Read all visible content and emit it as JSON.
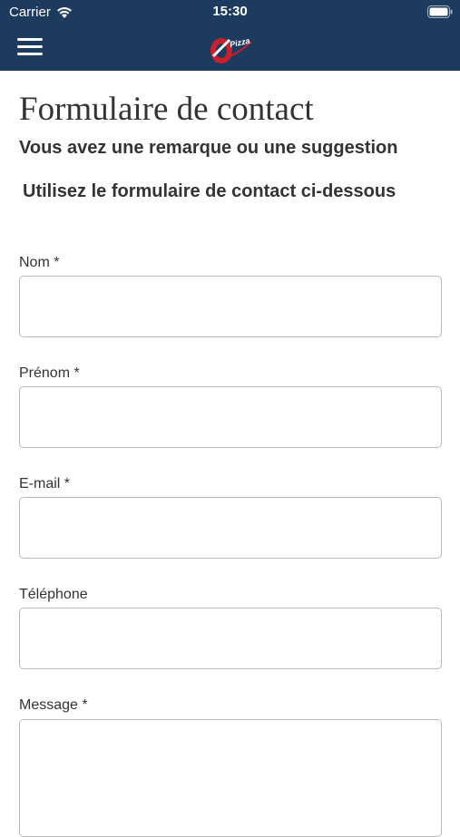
{
  "status_bar": {
    "carrier": "Carrier",
    "time": "15:30"
  },
  "nav": {
    "logo_text": "Pizza",
    "brand_color": "#1d3b5e"
  },
  "page": {
    "title": "Formulaire de contact",
    "subtitle": "Vous avez une remarque ou une suggestion",
    "instruction": "Utilisez le formulaire de contact ci-dessous"
  },
  "form": {
    "fields": [
      {
        "label": "Nom *",
        "value": ""
      },
      {
        "label": "Prénom *",
        "value": ""
      },
      {
        "label": "E-mail *",
        "value": ""
      },
      {
        "label": "Téléphone",
        "value": ""
      },
      {
        "label": "Message *",
        "value": ""
      }
    ]
  },
  "icons": {
    "wifi": "wifi-icon",
    "battery": "battery-icon",
    "menu": "hamburger-menu-icon"
  }
}
